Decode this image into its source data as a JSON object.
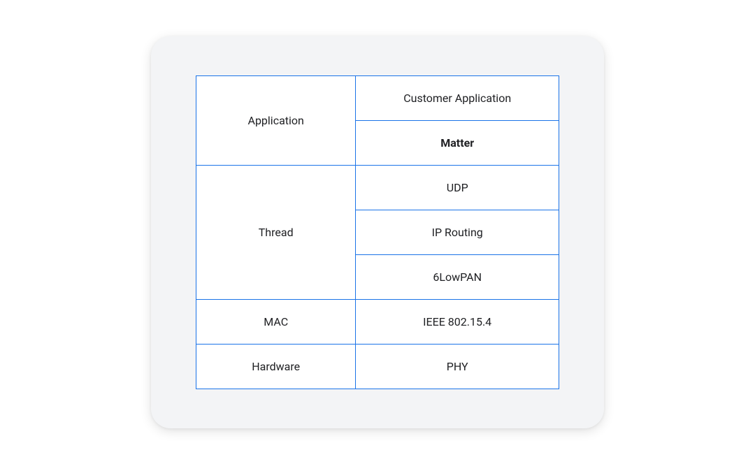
{
  "stack": {
    "rows": [
      {
        "left": "Application",
        "right": [
          "Customer Application",
          "Matter"
        ],
        "rightBold": [
          false,
          true
        ]
      },
      {
        "left": "Thread",
        "right": [
          "UDP",
          "IP Routing",
          "6LowPAN"
        ],
        "rightBold": [
          false,
          false,
          false
        ]
      },
      {
        "left": "MAC",
        "right": [
          "IEEE 802.15.4"
        ],
        "rightBold": [
          false
        ]
      },
      {
        "left": "Hardware",
        "right": [
          "PHY"
        ],
        "rightBold": [
          false
        ]
      }
    ]
  }
}
